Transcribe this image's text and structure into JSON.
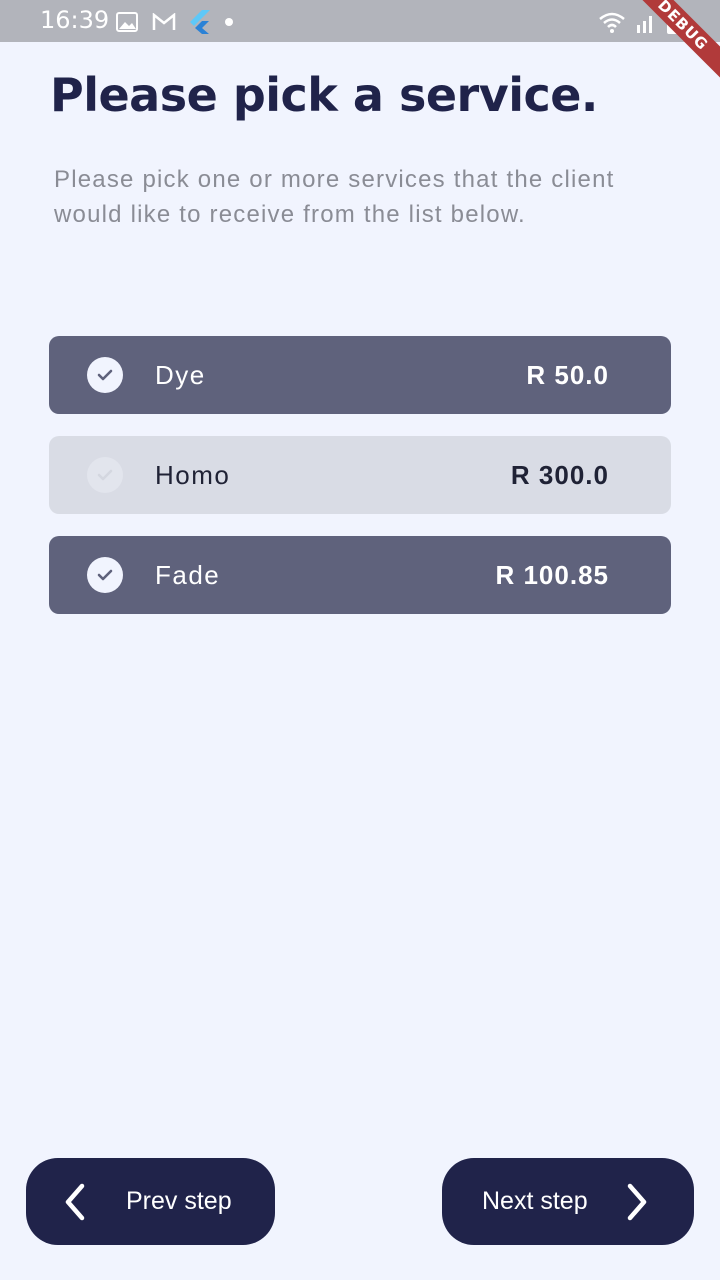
{
  "status_bar": {
    "time": "16:39",
    "icons_left": [
      "image-icon",
      "gmail-icon",
      "flutter-icon",
      "dot-icon"
    ],
    "icons_right": [
      "wifi-icon",
      "signal-icon",
      "battery-icon"
    ]
  },
  "debug_banner": "DEBUG",
  "page": {
    "title": "Please pick a service.",
    "subtitle": "Please pick one or more services that the client would like to receive from the list below."
  },
  "services": [
    {
      "name": "Dye",
      "price": "R 50.0",
      "selected": true
    },
    {
      "name": "Homo",
      "price": "R 300.0",
      "selected": false
    },
    {
      "name": "Fade",
      "price": "R 100.85",
      "selected": true
    }
  ],
  "nav": {
    "prev_label": "Prev step",
    "next_label": "Next step"
  },
  "colors": {
    "background": "#f1f4fe",
    "title": "#20234a",
    "selected_item": "#5f627c",
    "unselected_item": "#d9dce5",
    "button": "#20234a",
    "status_bar": "#b2b4bb",
    "debug_ribbon": "#b13a3a"
  }
}
